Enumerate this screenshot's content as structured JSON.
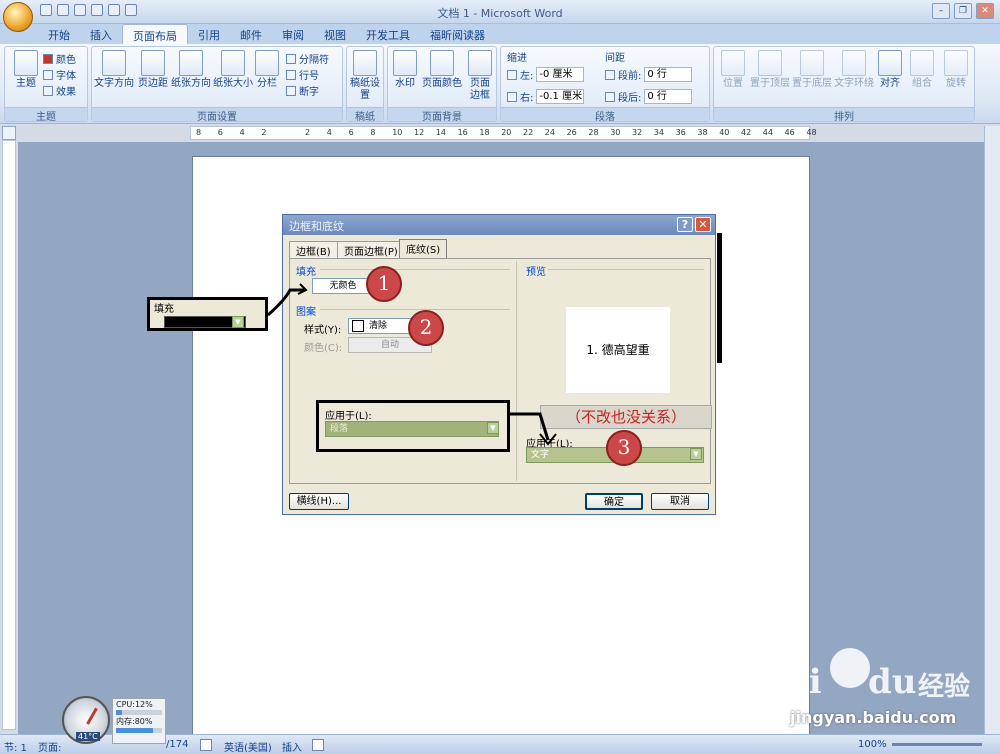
{
  "window": {
    "title": "文档 1 - Microsoft Word",
    "minimize": "–",
    "restore": "❐",
    "close": "✕"
  },
  "tabs": [
    "开始",
    "插入",
    "页面布局",
    "引用",
    "邮件",
    "审阅",
    "视图",
    "开发工具",
    "福昕阅读器"
  ],
  "active_tab": "页面布局",
  "ribbon": {
    "theme": {
      "label": "主题",
      "big": "主题",
      "colors": "颜色",
      "fonts": "字体",
      "effects": "效果"
    },
    "page_setup": {
      "label": "页面设置",
      "text_direction": "文字方向",
      "margins": "页边距",
      "orientation": "纸张方向",
      "size": "纸张大小",
      "columns": "分栏",
      "breaks": "分隔符",
      "line_numbers": "行号",
      "hyphenation": "断字"
    },
    "manuscript": {
      "label": "稿纸",
      "setup": "稿纸设置"
    },
    "page_background": {
      "label": "页面背景",
      "watermark": "水印",
      "page_color": "页面颜色",
      "page_borders": "页面边框"
    },
    "paragraph": {
      "label": "段落",
      "indent": "缩进",
      "left_label": "左:",
      "left_value": "-0 厘米",
      "right_label": "右:",
      "right_value": "-0.1 厘米",
      "spacing": "间距",
      "before_label": "段前:",
      "before_value": "0 行",
      "after_label": "段后:",
      "after_value": "0 行"
    },
    "arrange": {
      "label": "排列",
      "position": "位置",
      "bring_front": "置于顶层",
      "send_back": "置于底层",
      "wrap": "文字环绕",
      "align": "对齐",
      "group": "组合",
      "rotate": "旋转"
    }
  },
  "ruler": {
    "ticks": [
      "8",
      "6",
      "4",
      "2",
      "",
      "2",
      "4",
      "6",
      "8",
      "10",
      "12",
      "14",
      "16",
      "18",
      "20",
      "22",
      "24",
      "26",
      "28",
      "30",
      "32",
      "34",
      "36",
      "38",
      "40",
      "42",
      "44",
      "46",
      "48"
    ]
  },
  "dialog": {
    "title": "边框和底纹",
    "help": "?",
    "close": "✕",
    "tabs": [
      "边框(B)",
      "页面边框(P)",
      "底纹(S)"
    ],
    "fill_label": "填充",
    "fill_value": "无颜色",
    "pattern_label": "图案",
    "style_label": "样式(Y):",
    "style_value": "清除",
    "color_label": "颜色(C):",
    "color_value": "自动",
    "preview_label": "预览",
    "preview_text": "1.  德高望重",
    "apply_label": "应用于(L):",
    "apply_value": "文字",
    "lines_button": "横线(H)...",
    "ok": "确定",
    "cancel": "取消"
  },
  "annotations": {
    "fill_callout_label": "填充",
    "apply_callout_label": "应用于(L):",
    "apply_callout_value": "段落",
    "note": "（不改也没关系）",
    "steps": [
      "1",
      "2",
      "3"
    ]
  },
  "statusbar": {
    "line": "节: 1",
    "page": "页面:",
    "total": "/174",
    "language": "英语(美国)",
    "insert": "插入",
    "zoom": "100%"
  },
  "gadget": {
    "cpu": "CPU:12%",
    "memory": "内存:80%",
    "temp": "41°C",
    "cpu_pct": 12,
    "mem_pct": 80
  },
  "watermark": {
    "brand": "Bai",
    "brand2": "du",
    "jingyan": "经验",
    "url": "jingyan.baidu.com"
  },
  "colors": {
    "ribbon": "#dbe6f4",
    "dialog": "#ece9d8",
    "accent": "#cc4848"
  }
}
